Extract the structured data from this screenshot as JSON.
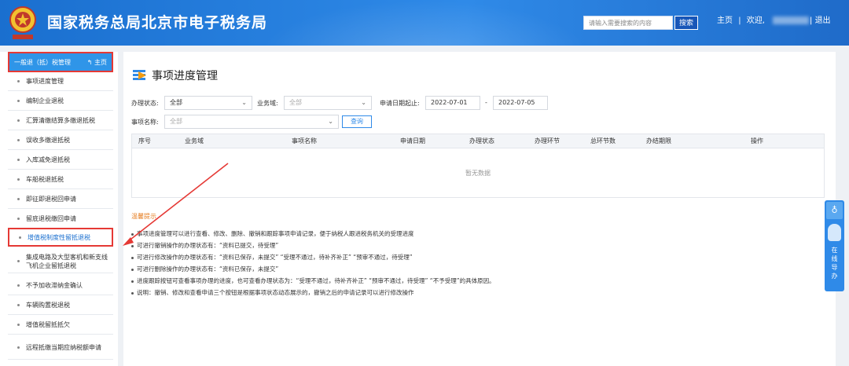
{
  "header": {
    "title": "国家税务总局北京市电子税务局",
    "search_placeholder": "请输入需要搜索的内容",
    "search_button": "搜索",
    "home_link": "主页",
    "welcome": "欢迎,",
    "logout": "退出"
  },
  "sidebar": {
    "section_title": "一般退（抵）税管理",
    "home_button": "主页",
    "items": [
      {
        "label": "事项进度管理"
      },
      {
        "label": "编制企业退税"
      },
      {
        "label": "汇算清缴结算多缴退抵税"
      },
      {
        "label": "误收多缴退抵税"
      },
      {
        "label": "入库减免退抵税"
      },
      {
        "label": "车船税退抵税"
      },
      {
        "label": "即征即退税回申请"
      },
      {
        "label": "留底退税缴回申请"
      },
      {
        "label": "增值税制度性留抵退税"
      },
      {
        "label": "集成电路及大型客机和新支线飞机企业留抵退税"
      },
      {
        "label": "不予加收滞纳金确认"
      },
      {
        "label": "车辆购置税退税"
      },
      {
        "label": "增值税留抵抵欠"
      },
      {
        "label": "远程抵缴当期应纳税额申请"
      }
    ]
  },
  "main": {
    "page_title": "事项进度管理",
    "filters": {
      "status_label": "办理状态:",
      "status_value": "全部",
      "domain_label": "业务域:",
      "domain_value": "全部",
      "date_label": "申请日期起止:",
      "date_start": "2022-07-01",
      "date_sep": "-",
      "date_end": "2022-07-05",
      "name_label": "事项名称:",
      "name_value": "全部",
      "query_button": "查询"
    },
    "table": {
      "columns": [
        "序号",
        "业务域",
        "事项名称",
        "申请日期",
        "办理状态",
        "办理环节",
        "总环节数",
        "办结期限",
        "操作"
      ],
      "empty_text": "暂无数据"
    },
    "tips": {
      "title": "温馨提示",
      "lines": [
        "事项进度管理可以进行查看、修改、删除、撤销和跟踪事项申请记录，便于纳税人跟进税务机关的受理进度",
        "可进行撤销操作的办理状态有：“资料已提交，待受理”",
        "可进行修改操作的办理状态有：“资料已保存，未提交” “受理不通过，待补齐补正” “预审不通过，待受理”",
        "可进行删除操作的办理状态有：“资料已保存，未提交”",
        "进度跟踪按钮可查看事项办理的进度，也可查看办理状态为：“受理不通过，待补齐补正” “预审不通过，待受理” “不予受理”的具体原因。",
        "说明：撤销、修改和查看申请三个按钮是根据事项状态动态展示的，撤销之后的申请记录可以进行修改操作"
      ]
    }
  },
  "float_widget": {
    "label_chars": [
      "在",
      "线",
      "导",
      "办"
    ]
  },
  "colors": {
    "header_blue": "#1a6fcf",
    "accent_blue": "#2f8ae8",
    "highlight_red": "#e53935",
    "tip_orange": "#e67e22"
  }
}
